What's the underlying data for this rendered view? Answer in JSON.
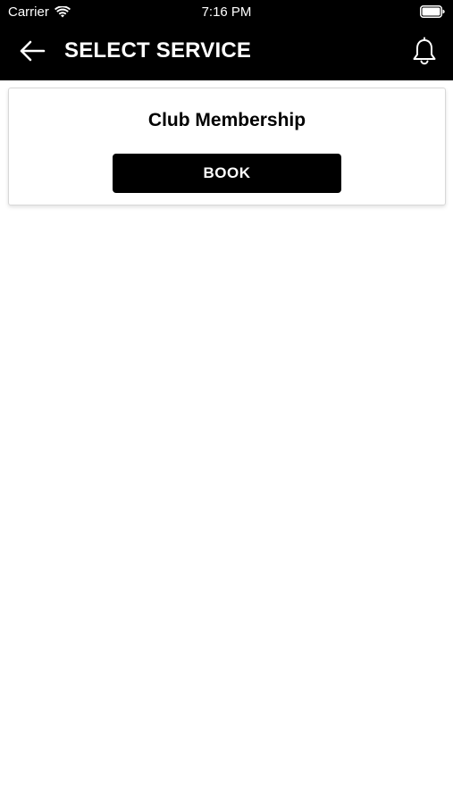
{
  "status_bar": {
    "carrier": "Carrier",
    "time": "7:16 PM",
    "wifi_icon": "wifi-icon",
    "battery_icon": "battery-full-icon"
  },
  "nav": {
    "back_icon": "arrow-left-icon",
    "title": "SELECT SERVICE",
    "notification_icon": "bell-icon"
  },
  "services": [
    {
      "name": "Club Membership",
      "action_label": "BOOK"
    }
  ],
  "colors": {
    "header_bg": "#000000",
    "header_text": "#ffffff",
    "button_bg": "#000000",
    "button_text": "#ffffff",
    "page_bg": "#ffffff"
  }
}
